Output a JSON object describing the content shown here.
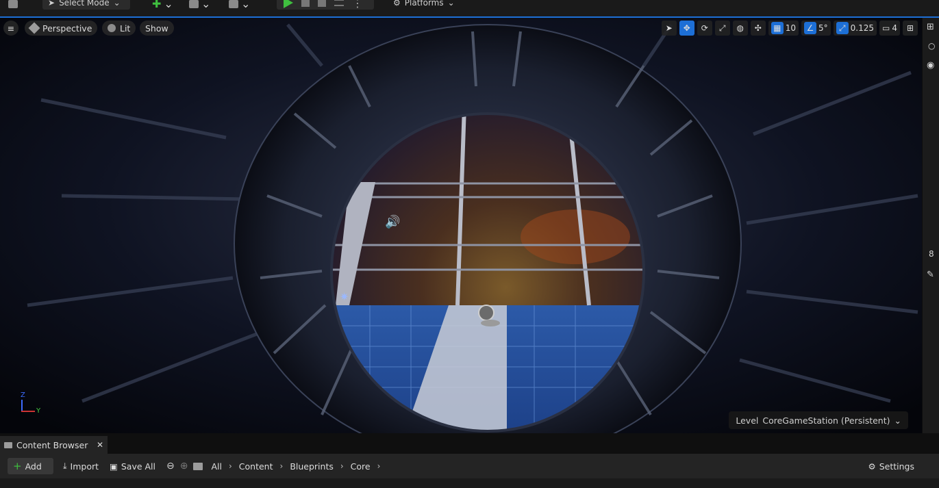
{
  "toolbar": {
    "select_mode": "Select Mode",
    "platforms": "Platforms"
  },
  "viewport": {
    "perspective": "Perspective",
    "lit": "Lit",
    "show": "Show",
    "grid_snap": "10",
    "rotation_snap": "5°",
    "scale_snap": "0.125",
    "camera_speed": "4",
    "axis_z": "Z",
    "axis_y": "Y",
    "level_label": "Level",
    "level_name": "CoreGameStation (Persistent)"
  },
  "right_edge": {
    "counter": "8"
  },
  "content_browser": {
    "tab_label": "Content Browser",
    "add": "Add",
    "import": "Import",
    "save_all": "Save All",
    "breadcrumbs": [
      "All",
      "Content",
      "Blueprints",
      "Core"
    ],
    "settings": "Settings"
  },
  "colors": {
    "accent": "#1d6fd6",
    "play": "#3fbf3f"
  }
}
